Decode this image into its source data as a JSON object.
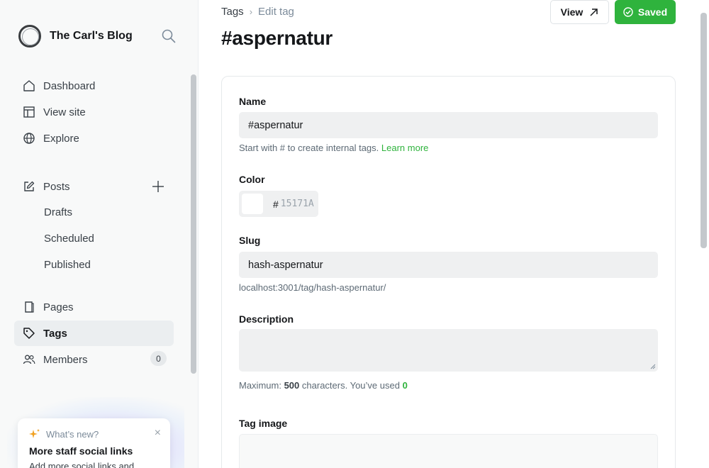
{
  "sidebar": {
    "blog_name": "The Carl's Blog",
    "nav": {
      "dashboard": "Dashboard",
      "view_site": "View site",
      "explore": "Explore",
      "posts": "Posts",
      "drafts": "Drafts",
      "scheduled": "Scheduled",
      "published": "Published",
      "pages": "Pages",
      "tags": "Tags",
      "members": "Members",
      "members_count": "0"
    },
    "whats_new": {
      "heading": "What’s new?",
      "close": "×",
      "title": "More staff social links",
      "text": "Add more social links and"
    }
  },
  "header": {
    "breadcrumb_parent": "Tags",
    "breadcrumb_sep": "›",
    "breadcrumb_current": "Edit tag",
    "title": "#aspernatur",
    "view_button": "View",
    "saved_button": "Saved"
  },
  "form": {
    "name_label": "Name",
    "name_value": "#aspernatur",
    "name_hint": "Start with # to create internal tags.",
    "name_hint_link": "Learn more",
    "color_label": "Color",
    "color_hash": "#",
    "color_placeholder": "15171A",
    "slug_label": "Slug",
    "slug_value": "hash-aspernatur",
    "slug_url": "localhost:3001/tag/hash-aspernatur/",
    "description_label": "Description",
    "description_hint_prefix": "Maximum:",
    "description_max": "500",
    "description_hint_mid": "characters. You’ve used",
    "description_used": "0",
    "image_label": "Tag image"
  },
  "colors": {
    "accent_green": "#2fb33d",
    "sidebar_bg": "#f8f9f9",
    "input_bg": "#eff0f1"
  }
}
